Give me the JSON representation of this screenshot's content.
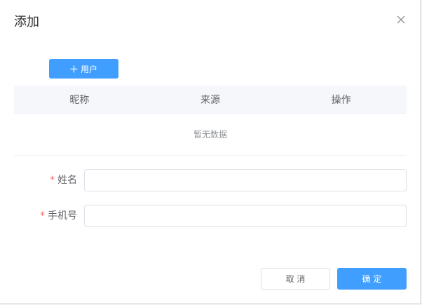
{
  "dialog": {
    "title": "添加"
  },
  "toolbar": {
    "add_user_label": "用户"
  },
  "table": {
    "columns": [
      "昵称",
      "来源",
      "操作"
    ],
    "empty_text": "暂无数据"
  },
  "form": {
    "name": {
      "label": "姓名",
      "required_mark": "*",
      "value": ""
    },
    "phone": {
      "label": "手机号",
      "required_mark": "*",
      "value": ""
    }
  },
  "footer": {
    "cancel_label": "取 消",
    "confirm_label": "确 定"
  },
  "colors": {
    "primary": "#409eff",
    "required": "#f56c6c",
    "header_bg": "#f5f7fa"
  }
}
